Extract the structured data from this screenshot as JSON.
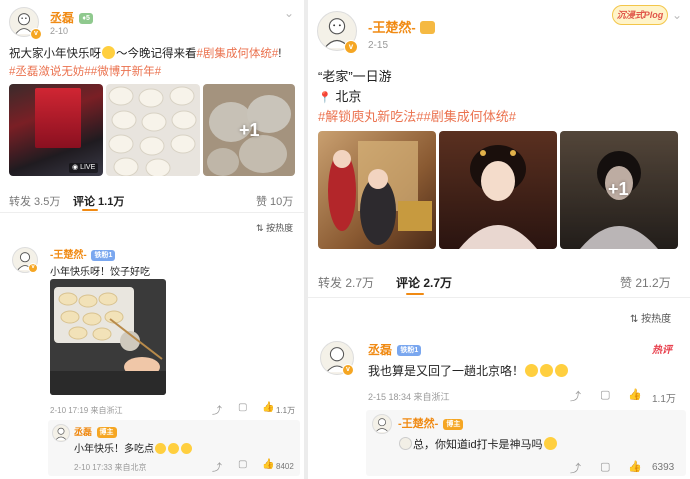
{
  "left_post": {
    "author": "丞磊",
    "author_level": "5",
    "date": "2-10",
    "text_plain": "祝大家小年快乐呀",
    "text_after_emoji": "～今晚记得来看",
    "topic_1": "#剧集成何体统#",
    "text_bang": "!",
    "topic_2": "#丞磊潋说无妨#",
    "topic_3": "#微博开新年#",
    "video_badge": "LIVE",
    "more_images": "+1",
    "stats": {
      "repost": "转发 3.5万",
      "comment": "评论 1.1万",
      "like": "赞 10万"
    },
    "sort_label": "按热度",
    "comment": {
      "author": "王楚然",
      "author_tag": "铁粉1",
      "text": "小年快乐呀！饺子好吃",
      "date_location": "2-10 17:19  来自浙江",
      "likes": "1.1万"
    },
    "reply": {
      "author": "丞磊",
      "author_tag": "博主",
      "text": "小年快乐！多吃点",
      "date_location": "2-10 17:33  来自北京",
      "likes": "8402"
    }
  },
  "right_post": {
    "author": "王楚然",
    "date": "2-15",
    "corner_logo": "沉浸式Plog",
    "line_1": "“老家”一日游",
    "location_icon": "📍",
    "line_2": "北京",
    "topic_1": "#解锁庾丸新吃法#",
    "topic_2": "#剧集成何体统#",
    "more_images": "+1",
    "stats": {
      "repost": "转发 2.7万",
      "comment": "评论 2.7万",
      "like": "赞 21.2万"
    },
    "sort_label": "按热度",
    "comment": {
      "author": "丞磊",
      "author_tag": "铁粉1",
      "hot_badge": "热评",
      "text": "我也算是又回了一趟北京咯！",
      "date_location": "2-15 18:34  来自浙江",
      "likes": "1.1万"
    },
    "reply": {
      "author": "王楚然",
      "author_tag": "博主",
      "text": "总，你知道id打卡是神马吗",
      "likes": "6393"
    }
  },
  "colors": {
    "accent": "#f08a13",
    "topic_link": "#eb7350",
    "hot_badge": "#e8414e"
  }
}
